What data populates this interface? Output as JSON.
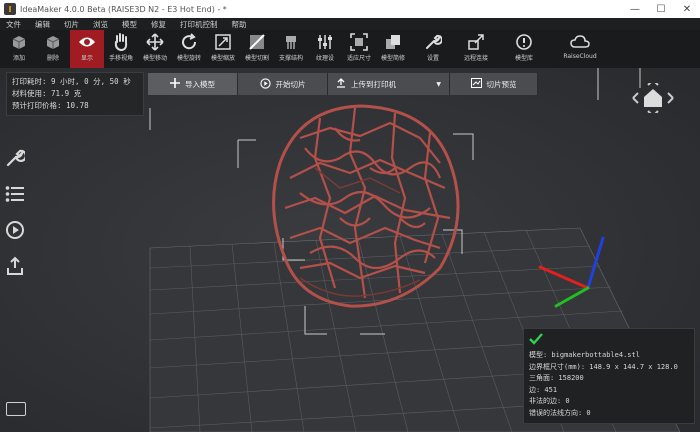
{
  "window": {
    "logo": "I",
    "title": "IdeaMaker 4.0.0 Beta (RAISE3D N2 - E3 Hot End) - *",
    "minimize": "—",
    "maximize": "☐",
    "close": "✕"
  },
  "menu": [
    "文件",
    "编辑",
    "切片",
    "浏览",
    "模型",
    "修复",
    "打印机控制",
    "帮助"
  ],
  "toolbar": [
    {
      "label": "添加",
      "icon": "add-model-icon"
    },
    {
      "label": "删除",
      "icon": "delete-model-icon"
    },
    {
      "label": "显示",
      "icon": "eye-icon",
      "active": true
    },
    {
      "label": "手移视角",
      "icon": "hand-icon"
    },
    {
      "label": "模型移动",
      "icon": "move-icon"
    },
    {
      "label": "模型旋转",
      "icon": "rotate-icon"
    },
    {
      "label": "模型缩放",
      "icon": "scale-icon"
    },
    {
      "label": "模型切割",
      "icon": "cut-icon"
    },
    {
      "label": "支撑结构",
      "icon": "support-icon"
    },
    {
      "label": "纹理设",
      "icon": "sliders-icon"
    },
    {
      "label": "适应尺寸",
      "icon": "fit-icon"
    },
    {
      "label": "模型简修",
      "icon": "repair-icon"
    },
    {
      "label": "设置",
      "icon": "wrench-icon"
    },
    {
      "label": "远程连接",
      "icon": "remote-icon"
    },
    {
      "label": "模型库",
      "icon": "library-icon"
    },
    {
      "label": "RaiseCloud",
      "icon": "cloud-icon"
    }
  ],
  "stats": {
    "time": "打印耗时: 9 小时, 0 分, 50 秒",
    "material": "材料使用: 71.9 克",
    "price": "预计打印价格: 10.78"
  },
  "actions": {
    "import": "导入模型",
    "slice": "开始切片",
    "upload": "上传到打印机",
    "upload_dropdown": "▼",
    "preview": "切片预览"
  },
  "model_info": {
    "name": "模型: bigmakerbottable4.stl",
    "bbox": "边界框尺寸(mm): 148.9 x 144.7 x 128.0",
    "triangles": "三角面: 158200",
    "edges": "边: 451",
    "nonmanifold": "非法的边: 0",
    "normals": "错误的法线方向: 0"
  },
  "colors": {
    "active": "#a01b22",
    "model": "#b4504a",
    "axis_x": "#e02020",
    "axis_y": "#20c020",
    "axis_z": "#2040e0",
    "ok": "#2fd04f"
  }
}
